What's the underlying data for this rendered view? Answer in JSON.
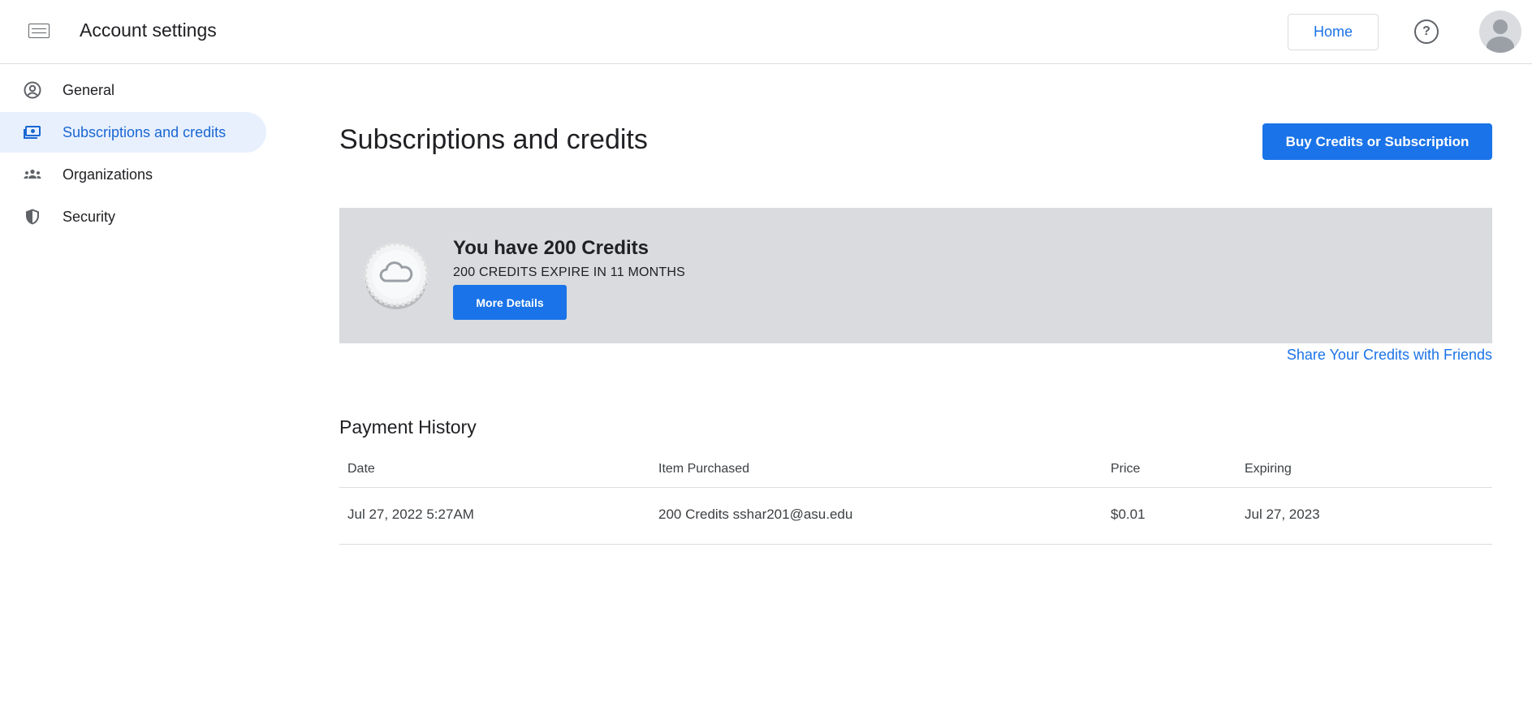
{
  "header": {
    "title": "Account settings",
    "home_label": "Home",
    "help_glyph": "?"
  },
  "sidebar": {
    "items": [
      {
        "label": "General",
        "icon": "account-circle-icon",
        "active": false
      },
      {
        "label": "Subscriptions and credits",
        "icon": "payments-icon",
        "active": true
      },
      {
        "label": "Organizations",
        "icon": "groups-icon",
        "active": false
      },
      {
        "label": "Security",
        "icon": "shield-icon",
        "active": false
      }
    ]
  },
  "main": {
    "title": "Subscriptions and credits",
    "buy_button": "Buy Credits or Subscription",
    "credits": {
      "title": "You have 200 Credits",
      "subtitle": "200 CREDITS EXPIRE IN 11 MONTHS",
      "details_button": "More Details",
      "icon": "cloud-coin-icon"
    },
    "share_link": "Share Your Credits with Friends",
    "payment_history": {
      "title": "Payment History",
      "columns": [
        "Date",
        "Item Purchased",
        "Price",
        "Expiring"
      ],
      "rows": [
        [
          "Jul 27, 2022 5:27AM",
          "200 Credits sshar201@asu.edu",
          "$0.01",
          "Jul 27, 2023"
        ]
      ]
    }
  },
  "colors": {
    "accent": "#1a73e8",
    "active_nav_bg": "#e8f0fe",
    "card_bg": "#d9dbde",
    "divider": "#dadce0"
  }
}
